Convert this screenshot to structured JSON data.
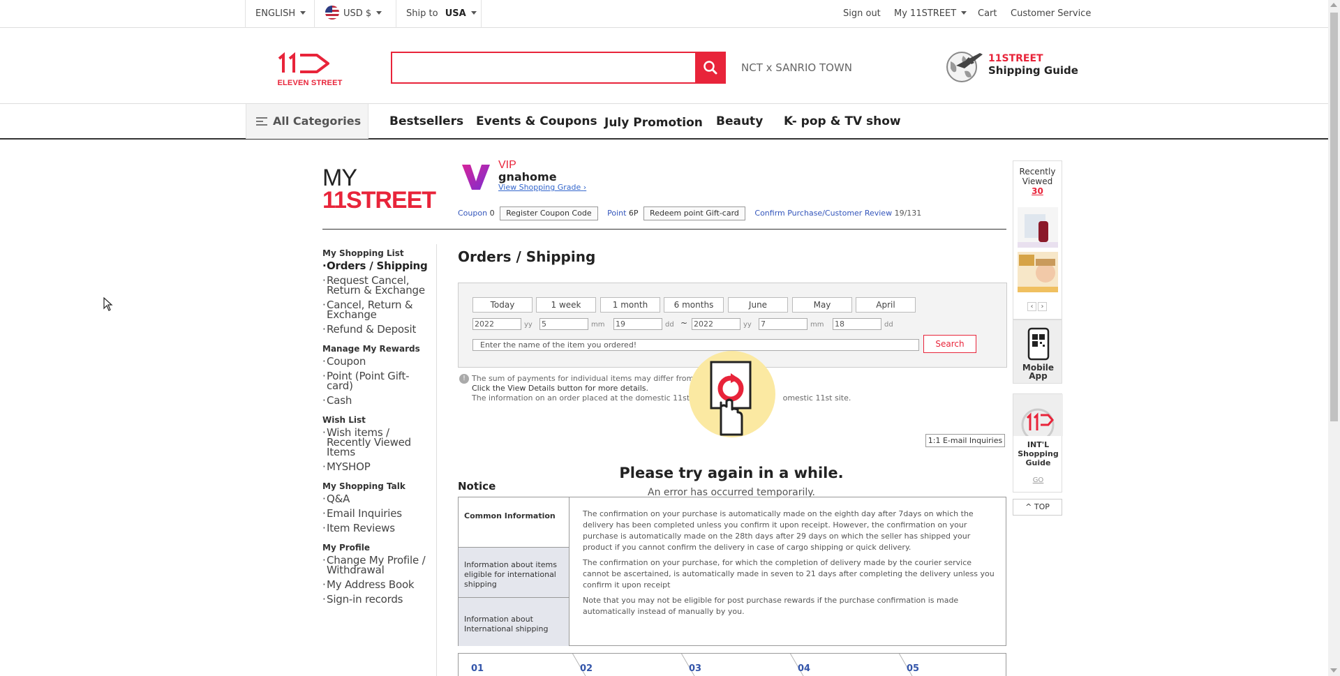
{
  "topbar": {
    "language": "ENGLISH",
    "currency": "USD $",
    "ship_to_label": "Ship to",
    "ship_to_value": "USA",
    "sign_out": "Sign out",
    "my_11street": "My 11STREET",
    "cart": "Cart",
    "customer_service": "Customer Service"
  },
  "header": {
    "logo_text": "ELEVEN STREET",
    "search_placeholder": "",
    "search_hint": "NCT x SANRIO TOWN",
    "shipping_guide_line1": "11STREET",
    "shipping_guide_line2": "Shipping Guide"
  },
  "nav": {
    "all_categories": "All Categories",
    "links": [
      "Bestsellers",
      "Events & Coupons",
      "July Promotion",
      "Beauty",
      "K- pop & TV show"
    ]
  },
  "my": {
    "title1": "MY",
    "title2": "11STREET",
    "grade": "VIP",
    "username": "gnahome",
    "view_grade": "View Shopping Grade",
    "coupon_label": "Coupon",
    "coupon_count": "0",
    "register_coupon": "Register Coupon Code",
    "point_label": "Point",
    "point_value": "6P",
    "redeem_point": "Redeem point Gift-card",
    "confirm_label": "Confirm Purchase/Customer Review",
    "confirm_count": "19/131"
  },
  "sidebar": {
    "sections": [
      {
        "head": "My Shopping List",
        "items": [
          "Orders / Shipping",
          "Request Cancel, Return & Exchange",
          "Cancel, Return & Exchange",
          "Refund & Deposit"
        ]
      },
      {
        "head": "Manage My Rewards",
        "items": [
          "Coupon",
          "Point (Point Gift-card)",
          "Cash"
        ]
      },
      {
        "head": "Wish List",
        "items": [
          "Wish items / Recently Viewed Items",
          "MYSHOP"
        ]
      },
      {
        "head": "My Shopping Talk",
        "items": [
          "Q&A",
          "Email Inquiries",
          "Item Reviews"
        ]
      },
      {
        "head": "My Profile",
        "items": [
          "Change My Profile / Withdrawal",
          "My Address Book",
          "Sign-in records"
        ]
      }
    ]
  },
  "orders": {
    "title": "Orders / Shipping",
    "periods": [
      "Today",
      "1 week",
      "1 month",
      "6 months",
      "June",
      "May",
      "April"
    ],
    "from_yy": "2022",
    "from_mm": "5",
    "from_dd": "19",
    "to_yy": "2022",
    "to_mm": "7",
    "to_dd": "18",
    "yy": "yy",
    "mm": "mm",
    "dd": "dd",
    "tilde": "~",
    "item_placeholder": "Enter the name of the item you ordered!",
    "search": "Search",
    "info_line1": "The sum of payments for individual items may differ from the",
    "info_line2": "Click the View Details button for more details.",
    "info_line3a": "The information on an order placed at the domestic 11st site",
    "info_line3b": "omestic 11st site.",
    "email_inquiries": "1:1 E-mail Inquiries"
  },
  "error": {
    "title": "Please try again in a while.",
    "subtitle": "An error has occurred temporarily."
  },
  "notice": {
    "title": "Notice",
    "tabs": [
      "Common Information",
      "Information about items eligible for international shipping",
      "Information about International shipping"
    ],
    "paragraphs": [
      "The confirmation on your purchase is automatically made on the eighth day after 7days on which the delivery has been completed unless you confirm it upon receipt. However, the confirmation on your purchase is automatically made on the 28th days after 29 days on which the seller has shipped your product if you cannot confirm the delivery in case of cargo shipping or quick delivery.",
      "The confirmation on your purchase, for which the completion of delivery made by the courier service cannot be ascertained, is automatically made in seven to 21 days after completing the delivery unless you confirm it upon receipt",
      "Note that you may not be eligible for post purchase rewards if the purchase confirmation is made automatically instead of manually by you."
    ]
  },
  "steps": [
    "01",
    "02",
    "03",
    "04",
    "05"
  ],
  "right": {
    "recently_viewed": "Recently Viewed",
    "count": "30",
    "prev": "‹",
    "next": "›",
    "mobile_app": "Mobile App",
    "intl_guide": "INT'L Shopping Guide",
    "go": "GO",
    "top": "TOP"
  },
  "colors": {
    "brand": "#e8243a",
    "link": "#3355bb"
  }
}
